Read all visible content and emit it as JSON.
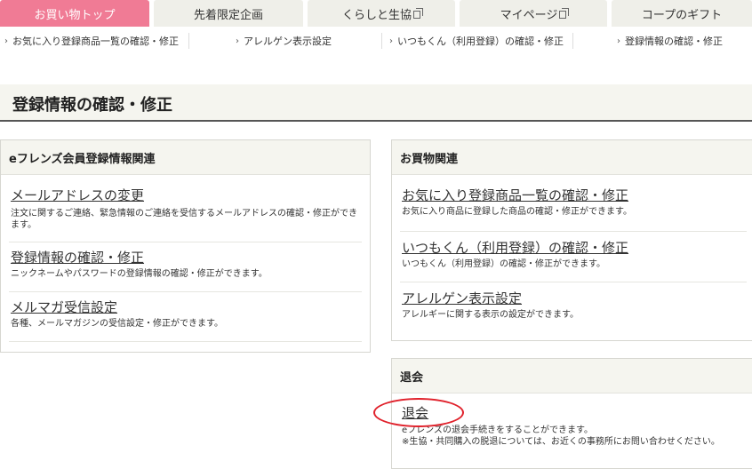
{
  "tabs": [
    {
      "label": "お買い物トップ",
      "active": true,
      "external": false
    },
    {
      "label": "先着限定企画",
      "active": false,
      "external": false
    },
    {
      "label": "くらしと生協",
      "active": false,
      "external": true
    },
    {
      "label": "マイページ",
      "active": false,
      "external": true
    },
    {
      "label": "コープのギフト",
      "active": false,
      "external": false
    }
  ],
  "subnav": [
    "お気に入り登録商品一覧の確認・修正",
    "アレルゲン表示設定",
    "いつもくん（利用登録）の確認・修正",
    "登録情報の確認・修正"
  ],
  "page_title": "登録情報の確認・修正",
  "panels": {
    "member": {
      "title": "eフレンズ会員登録情報関連",
      "items": [
        {
          "link": "メールアドレスの変更",
          "desc": "注文に関するご連絡、緊急情報のご連絡を受信するメールアドレスの確認・修正ができます。"
        },
        {
          "link": "登録情報の確認・修正",
          "desc": "ニックネームやパスワードの登録情報の確認・修正ができます。"
        },
        {
          "link": "メルマガ受信設定",
          "desc": "各種、メールマガジンの受信設定・修正ができます。"
        }
      ]
    },
    "shopping": {
      "title": "お買物関連",
      "items": [
        {
          "link": "お気に入り登録商品一覧の確認・修正",
          "desc": "お気に入り商品に登録した商品の確認・修正ができます。"
        },
        {
          "link": "いつもくん（利用登録）の確認・修正",
          "desc": "いつもくん（利用登録）の確認・修正ができます。"
        },
        {
          "link": "アレルゲン表示設定",
          "desc": "アレルギーに関する表示の設定ができます。"
        }
      ]
    },
    "withdraw": {
      "title": "退会",
      "items": [
        {
          "link": "退会",
          "desc": "eフレンズの退会手続きをすることができます。",
          "note": "※生協・共同購入の脱退については、お近くの事務所にお問い合わせください。"
        }
      ]
    }
  },
  "colors": {
    "active_tab": "#f07b95",
    "tab_bg": "#efefe9",
    "panel_head_bg": "#f5f5ef",
    "highlight_circle": "#e0202a"
  }
}
